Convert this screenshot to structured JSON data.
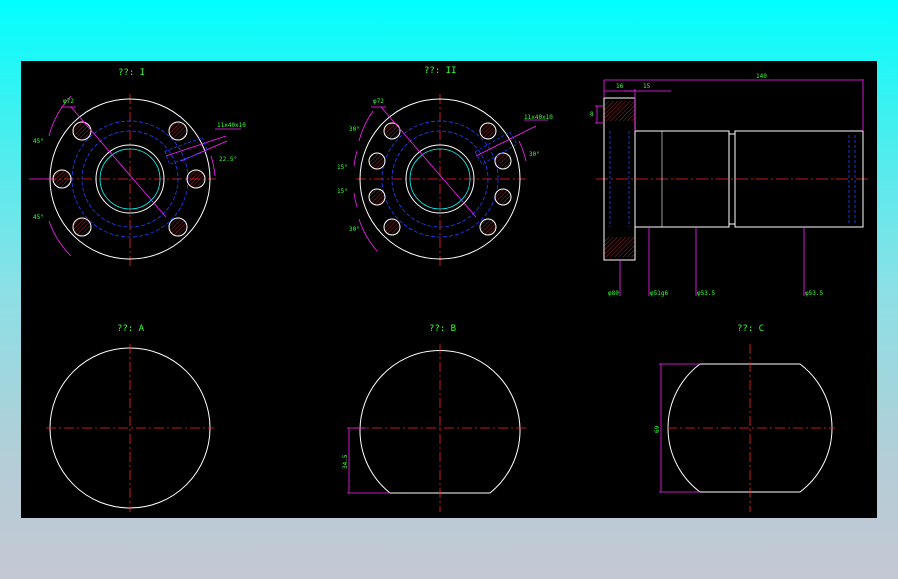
{
  "views": {
    "view_1": {
      "title": "??: I"
    },
    "view_2": {
      "title": "??: II"
    },
    "view_a": {
      "title": "??: A"
    },
    "view_b": {
      "title": "??: B"
    },
    "view_c": {
      "title": "??: C"
    }
  },
  "dimensions": {
    "v1_diameter": "φ72",
    "v1_thread": "11x40x10",
    "v1_angle_top": "45°",
    "v1_angle_bottom": "45°",
    "v1_angle_right": "22.5°",
    "v2_diameter": "φ72",
    "v2_thread": "11x40x10",
    "v2_angle_30a": "30°",
    "v2_angle_15a": "15°",
    "v2_angle_15b": "15°",
    "v2_angle_30b": "30°",
    "v2_angle_right": "30°",
    "side_16": "16",
    "side_15": "15",
    "side_140": "140",
    "side_left": "8",
    "side_d1": "φ80",
    "side_d2": "φ51g6",
    "side_d3": "φ53.5",
    "side_d4": "φ53.5",
    "vb_height": "34.5",
    "vc_height": "69"
  },
  "colors": {
    "background": "#000000",
    "outline": "#ffffff",
    "centerline": "#ff2020",
    "hidden": "#2040ff",
    "dimension": "#ff20ff",
    "text": "#33ff33",
    "thread": "#00ffff"
  }
}
